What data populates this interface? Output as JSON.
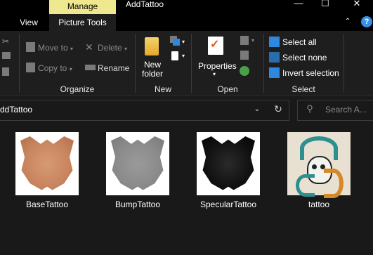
{
  "titlebar": {
    "context_tab": "Manage",
    "title": "AddTattoo",
    "min_glyph": "—",
    "max_glyph": "☐",
    "close_glyph": "✕"
  },
  "tabs": [
    {
      "label": "View"
    },
    {
      "label": "Picture Tools"
    }
  ],
  "ribbon": {
    "organize": {
      "move_to": "Move to",
      "copy_to": "Copy to",
      "delete": "Delete",
      "rename": "Rename",
      "label": "Organize"
    },
    "new": {
      "new_folder": "New\nfolder",
      "label": "New"
    },
    "open": {
      "properties": "Properties",
      "label": "Open"
    },
    "select": {
      "select_all": "Select all",
      "select_none": "Select none",
      "invert": "Invert selection",
      "label": "Select"
    }
  },
  "address": {
    "path": "ddTattoo",
    "search_placeholder": "Search A..."
  },
  "files": [
    {
      "name": "BaseTattoo"
    },
    {
      "name": "BumpTattoo"
    },
    {
      "name": "SpecularTattoo"
    },
    {
      "name": "tattoo"
    }
  ],
  "colors": {
    "manage_tab": "#f0e88e",
    "select_icons": "#2f88e0",
    "background": "#191919"
  }
}
